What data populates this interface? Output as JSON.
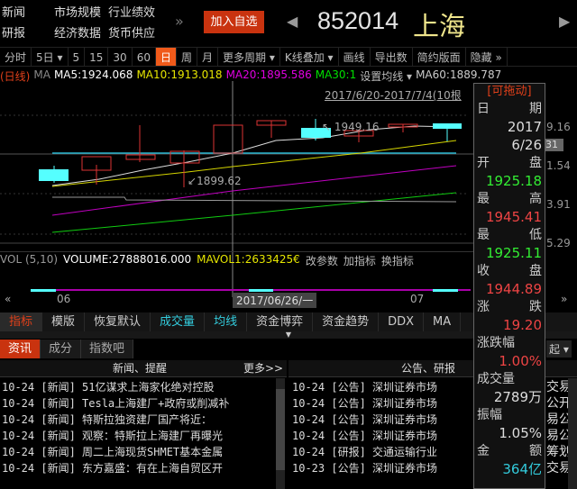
{
  "topnav": [
    "新闻",
    "市场规模",
    "行业绩效",
    "研报",
    "经济数据",
    "货币供应"
  ],
  "more": "»",
  "add_watch": "加入自选",
  "prev": "◀",
  "next": "▶",
  "code": "852014",
  "name": "上海",
  "toolbar": [
    "分时",
    "5日 ▾",
    "5",
    "15",
    "30",
    "60",
    "日",
    "周",
    "月",
    "更多周期 ▾",
    "K线叠加 ▾",
    "画线",
    "导出数",
    "简约版面",
    "隐藏 »"
  ],
  "ma": {
    "period": "(日线)",
    "label": "MA",
    "ma5": "MA5:1924.068",
    "ma10": "MA10:1913.018",
    "ma20": "MA20:1895.586",
    "ma30": "MA30:1",
    "set": "设置均线 ▾",
    "ma60": "MA60:1889.787"
  },
  "range": "2017/6/20-2017/7/4(10根",
  "annot_high": "1949.16",
  "annot_low": "1899.62",
  "axis": [
    "9.16",
    "1.54",
    "3.91",
    "5.29"
  ],
  "axis_box": "31",
  "vol": {
    "label": "VOL (5,10)",
    "volume": "VOLUME:27888016.000",
    "mavol": "MAVOL1:2633425€",
    "btns": [
      "改参数",
      "加指标",
      "换指标"
    ]
  },
  "dates": {
    "d1": "06",
    "cursor": "2017/06/26/一",
    "d2": "07",
    "left": "«",
    "right": "»"
  },
  "ind_tabs": [
    "指标",
    "模版",
    "恢复默认",
    "成交量",
    "均线",
    "资金博弈",
    "资金趋势",
    "DDX",
    "MA"
  ],
  "info_tabs": [
    "资讯",
    "成分",
    "指数吧"
  ],
  "sort": "起 ▾",
  "panel": {
    "drag": "[可拖动]",
    "date_l": [
      "日",
      "期"
    ],
    "year": "2017",
    "md": "6/26",
    "open_l": [
      "开",
      "盘"
    ],
    "open": "1925.18",
    "high_l": [
      "最",
      "高"
    ],
    "high": "1945.41",
    "low_l": [
      "最",
      "低"
    ],
    "low": "1925.11",
    "close_l": [
      "收",
      "盘"
    ],
    "close": "1944.89",
    "chg_l": [
      "涨",
      "跌"
    ],
    "chg": "19.20",
    "pct_l": "涨跌幅",
    "pct": "1.00%",
    "vol_l": "成交量",
    "vol": "2789万",
    "amp_l": "振幅",
    "amp": "1.05%",
    "amt_l": [
      "金",
      "额"
    ],
    "amt": "364亿"
  },
  "news": {
    "title": "新闻、提醒",
    "more": "更多>>",
    "rows": [
      "10-24 [新闻] 51亿谋求上海家化绝对控股",
      "10-24 [新闻] Tesla上海建厂+政府或削减补",
      "10-24 [新闻] 特斯拉独资建厂国产将近：",
      "10-24 [新闻] 观察：特斯拉上海建厂再曝光",
      "10-24 [新闻] 周二上海现货SHMET基本金属",
      "10-24 [新闻] 东方嘉盛：有在上海自贸区开"
    ]
  },
  "notices": {
    "title": "公告、研报",
    "rows": [
      "10-24 [公告] 深圳证券市场",
      "10-24 [公告] 深圳证券市场",
      "10-24 [公告] 深圳证券市场",
      "10-24 [公告] 深圳证券市场",
      "10-24 [研报] 交通运输行业",
      "10-23 [公告] 深圳证券市场"
    ],
    "tail": [
      "交易",
      "公开",
      "易公",
      "易公",
      "筹划",
      "交易"
    ]
  }
}
